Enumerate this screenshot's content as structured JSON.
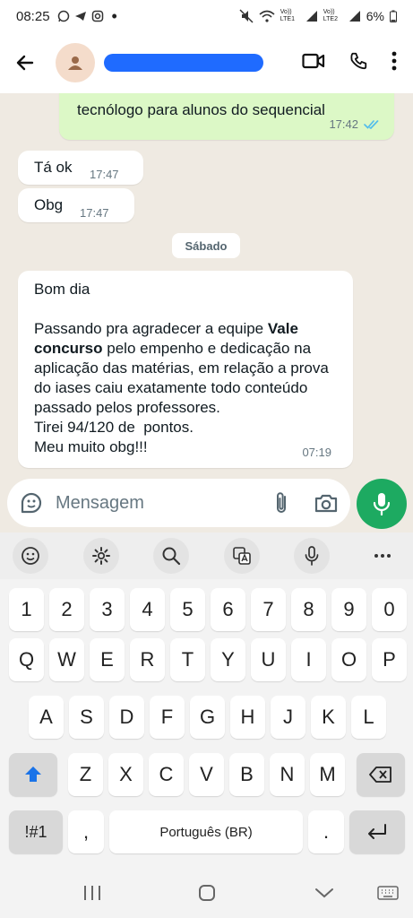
{
  "status_bar": {
    "time": "08:25",
    "battery": "6%",
    "sim1": "Vo)) LTE1",
    "sim2": "Vo)) LTE2"
  },
  "header": {
    "back_icon": "arrow-left-icon",
    "video_icon": "video-call-icon",
    "call_icon": "phone-icon",
    "menu_icon": "more-vertical-icon"
  },
  "messages": [
    {
      "type": "outgoing",
      "text": "tecnólogo para alunos do sequencial",
      "time": "17:42"
    },
    {
      "type": "incoming",
      "text": "Tá ok",
      "time": "17:47"
    },
    {
      "type": "incoming",
      "text": "Obg",
      "time": "17:47"
    },
    {
      "type": "incoming",
      "time": "07:19",
      "greeting": "Bom dia",
      "p_before": "Passando pra agradecer a equipe ",
      "bold": "Vale concurso",
      "p_after": " pelo empenho e dedicação na aplicação das matérias, em relação a prova do iases caiu exatamente todo conteúdo passado pelos professores.",
      "line2": "Tirei 94/120 de  pontos.",
      "line3": "Meu muito obg!!!"
    }
  ],
  "date_chip": "Sábado",
  "compose": {
    "placeholder": "Mensagem"
  },
  "keyboard": {
    "row_numbers": [
      "1",
      "2",
      "3",
      "4",
      "5",
      "6",
      "7",
      "8",
      "9",
      "0"
    ],
    "row1": [
      "Q",
      "W",
      "E",
      "R",
      "T",
      "Y",
      "U",
      "I",
      "O",
      "P"
    ],
    "row2": [
      "A",
      "S",
      "D",
      "F",
      "G",
      "H",
      "J",
      "K",
      "L"
    ],
    "row3": [
      "Z",
      "X",
      "C",
      "V",
      "B",
      "N",
      "M"
    ],
    "symbols_key": "!#1",
    "comma_key": ",",
    "space_label": "Português (BR)",
    "period_key": "."
  }
}
